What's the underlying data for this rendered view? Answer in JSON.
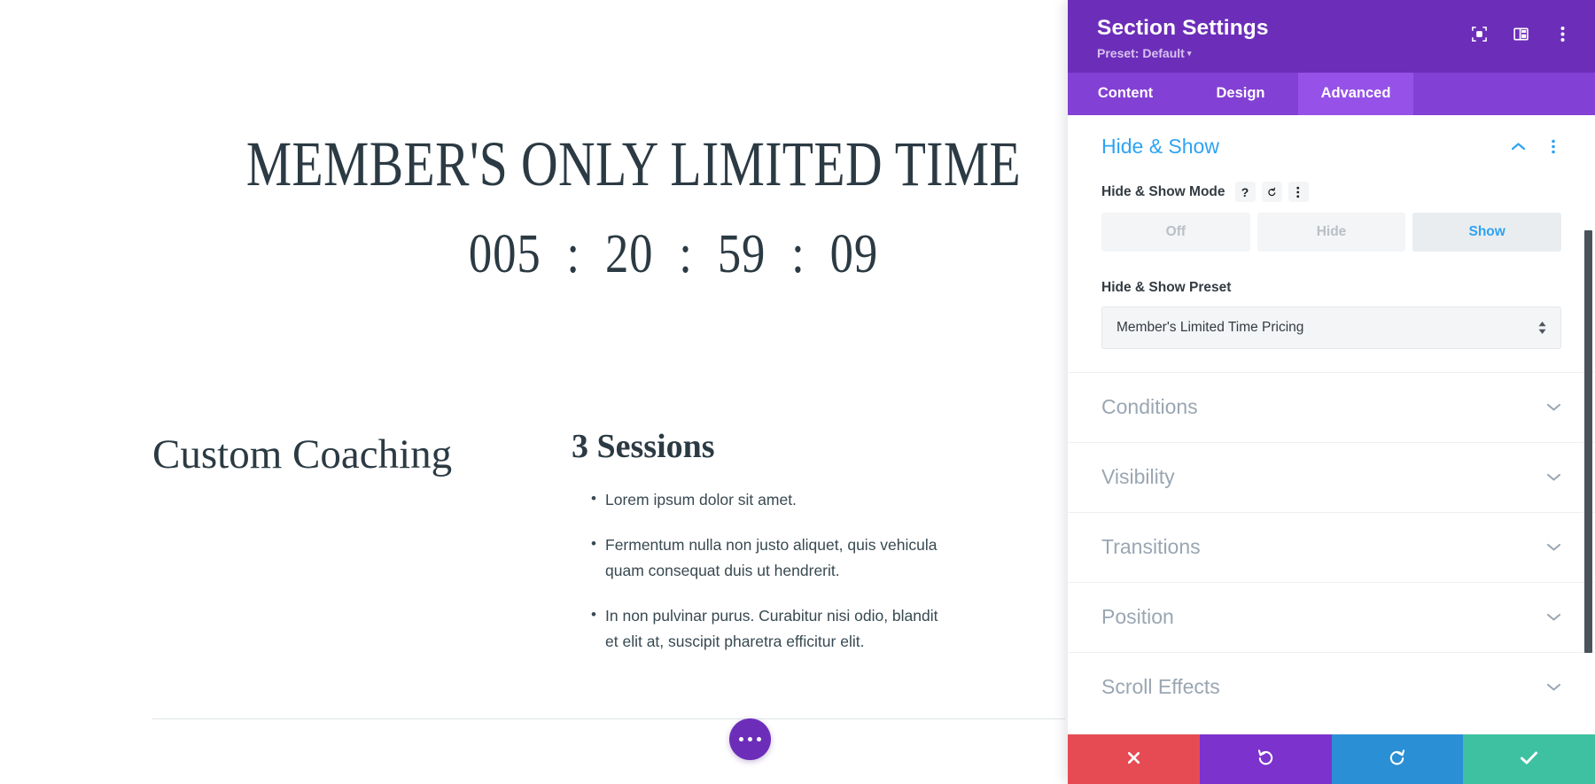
{
  "page": {
    "hero_title": "MEMBER'S ONLY LIMITED TIME",
    "countdown": {
      "days": "005",
      "hours": "20",
      "minutes": "59",
      "seconds": "09",
      "separator": ":"
    },
    "left_column_title": "Custom Coaching",
    "right_column_title": "3 Sessions",
    "features": [
      "Lorem ipsum dolor sit amet.",
      "Fermentum nulla non justo aliquet, quis vehicula quam consequat duis ut hendrerit.",
      "In non pulvinar purus. Curabitur nisi odio, blandit et elit at, suscipit pharetra efficitur elit."
    ],
    "fab_label": "more-options",
    "text_color": "#2b3a43"
  },
  "panel": {
    "title": "Section Settings",
    "preset_label": "Preset: Default",
    "preset_caret": "▾",
    "header_icons": [
      {
        "name": "focus-icon",
        "label": "Focus"
      },
      {
        "name": "layout-columns-icon",
        "label": "Layout"
      },
      {
        "name": "kebab-menu-icon",
        "label": "More"
      }
    ],
    "tabs": [
      {
        "label": "Content",
        "active": false
      },
      {
        "label": "Design",
        "active": false
      },
      {
        "label": "Advanced",
        "active": true
      }
    ],
    "accent_purple": "#6c2eb9",
    "accent_blue": "#2ea3f2",
    "open_section": {
      "title": "Hide & Show",
      "collapse_icon": "chevron-up",
      "menu_icon": "kebab-menu",
      "mode_field": {
        "label": "Hide & Show Mode",
        "tools": [
          {
            "name": "help-icon",
            "glyph": "?"
          },
          {
            "name": "reset-icon",
            "glyph": "↺"
          },
          {
            "name": "kebab-menu-icon",
            "glyph": "⋮"
          }
        ],
        "options": [
          {
            "label": "Off",
            "selected": false
          },
          {
            "label": "Hide",
            "selected": false
          },
          {
            "label": "Show",
            "selected": true
          }
        ]
      },
      "preset_field": {
        "label": "Hide & Show Preset",
        "value": "Member's Limited Time Pricing"
      }
    },
    "closed_sections": [
      {
        "label": "Conditions"
      },
      {
        "label": "Visibility"
      },
      {
        "label": "Transitions"
      },
      {
        "label": "Position"
      },
      {
        "label": "Scroll Effects"
      }
    ],
    "footer_buttons": [
      {
        "name": "cancel-button",
        "icon": "close-icon",
        "color": "#e64b53"
      },
      {
        "name": "undo-button",
        "icon": "undo-icon",
        "color": "#7c32cc"
      },
      {
        "name": "redo-button",
        "icon": "redo-icon",
        "color": "#2a8fd4"
      },
      {
        "name": "save-button",
        "icon": "check-icon",
        "color": "#3ec1a0"
      }
    ]
  }
}
